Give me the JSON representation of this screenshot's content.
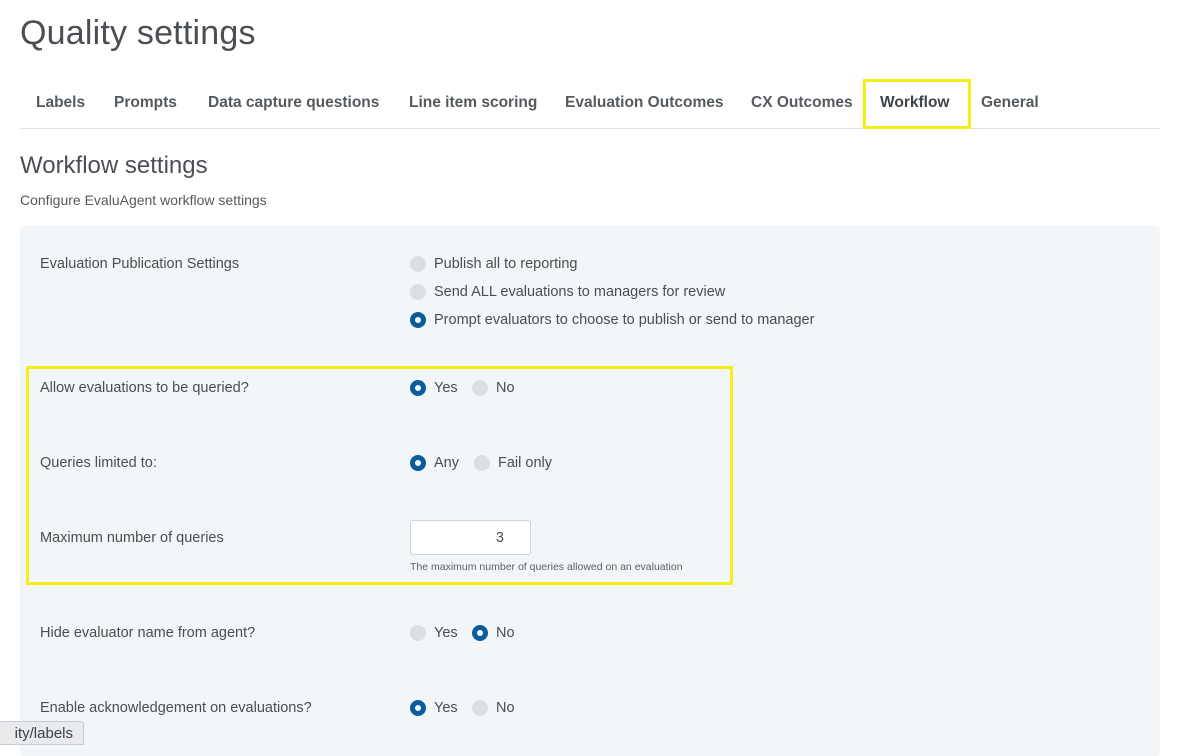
{
  "page": {
    "title": "Quality settings"
  },
  "tabs": [
    {
      "label": "Labels"
    },
    {
      "label": "Prompts"
    },
    {
      "label": "Data capture questions"
    },
    {
      "label": "Line item scoring"
    },
    {
      "label": "Evaluation Outcomes"
    },
    {
      "label": "CX Outcomes"
    },
    {
      "label": "Workflow",
      "active": true
    },
    {
      "label": "General"
    }
  ],
  "section": {
    "title": "Workflow settings",
    "subtitle": "Configure EvaluAgent workflow settings"
  },
  "settings": {
    "publication": {
      "label": "Evaluation Publication Settings",
      "options": [
        "Publish all to reporting",
        "Send ALL evaluations to managers for review",
        "Prompt evaluators to choose to publish or send to manager"
      ],
      "selected": 2
    },
    "allow_queries": {
      "label": "Allow evaluations to be queried?",
      "options": [
        "Yes",
        "No"
      ],
      "selected": 0
    },
    "queries_limited": {
      "label": "Queries limited to:",
      "options": [
        "Any",
        "Fail only"
      ],
      "selected": 0
    },
    "max_queries": {
      "label": "Maximum number of queries",
      "value": "3",
      "help": "The maximum number of queries allowed on an evaluation"
    },
    "hide_evaluator": {
      "label": "Hide evaluator name from agent?",
      "options": [
        "Yes",
        "No"
      ],
      "selected": 1
    },
    "acknowledgement": {
      "label": "Enable acknowledgement on evaluations?",
      "options": [
        "Yes",
        "No"
      ],
      "selected": 0
    }
  },
  "status_bar": {
    "url": "ity/labels"
  },
  "colors": {
    "accent": "#0a5c9a",
    "highlight": "#f4ee1a",
    "panel_bg": "#f3f6f9"
  }
}
